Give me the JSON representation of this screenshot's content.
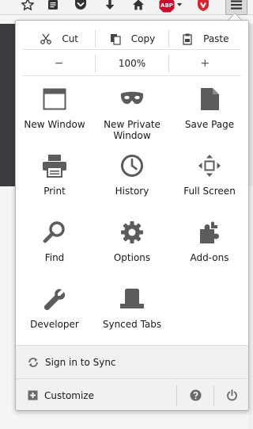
{
  "toolbar": {
    "icons": [
      "star-icon",
      "reading-list-icon",
      "pocket-icon",
      "download-icon",
      "home-icon",
      "adblock-plus-icon",
      "shield-extension-icon",
      "hamburger-menu-icon"
    ],
    "abp_badge": "ABP"
  },
  "menu": {
    "edit": {
      "cut": "Cut",
      "copy": "Copy",
      "paste": "Paste"
    },
    "zoom": {
      "minus": "−",
      "level": "100%",
      "plus": "+"
    },
    "items": [
      {
        "label": "New Window",
        "icon": "window-icon"
      },
      {
        "label": "New Private\nWindow",
        "icon": "mask-icon"
      },
      {
        "label": "Save Page",
        "icon": "save-page-icon"
      },
      {
        "label": "Print",
        "icon": "printer-icon"
      },
      {
        "label": "History",
        "icon": "clock-icon"
      },
      {
        "label": "Full Screen",
        "icon": "fullscreen-icon"
      },
      {
        "label": "Find",
        "icon": "magnifier-icon"
      },
      {
        "label": "Options",
        "icon": "gear-icon"
      },
      {
        "label": "Add-ons",
        "icon": "puzzle-icon"
      },
      {
        "label": "Developer",
        "icon": "wrench-icon"
      },
      {
        "label": "Synced Tabs",
        "icon": "synced-tabs-icon"
      }
    ],
    "sync": {
      "label": "Sign in to Sync"
    },
    "customize": {
      "label": "Customize"
    }
  },
  "colors": {
    "icon_gray": "#5c5c5c",
    "abp_red": "#c70d2c",
    "panel_bg": "#ffffff",
    "footer_bg": "#f1f1f1"
  }
}
